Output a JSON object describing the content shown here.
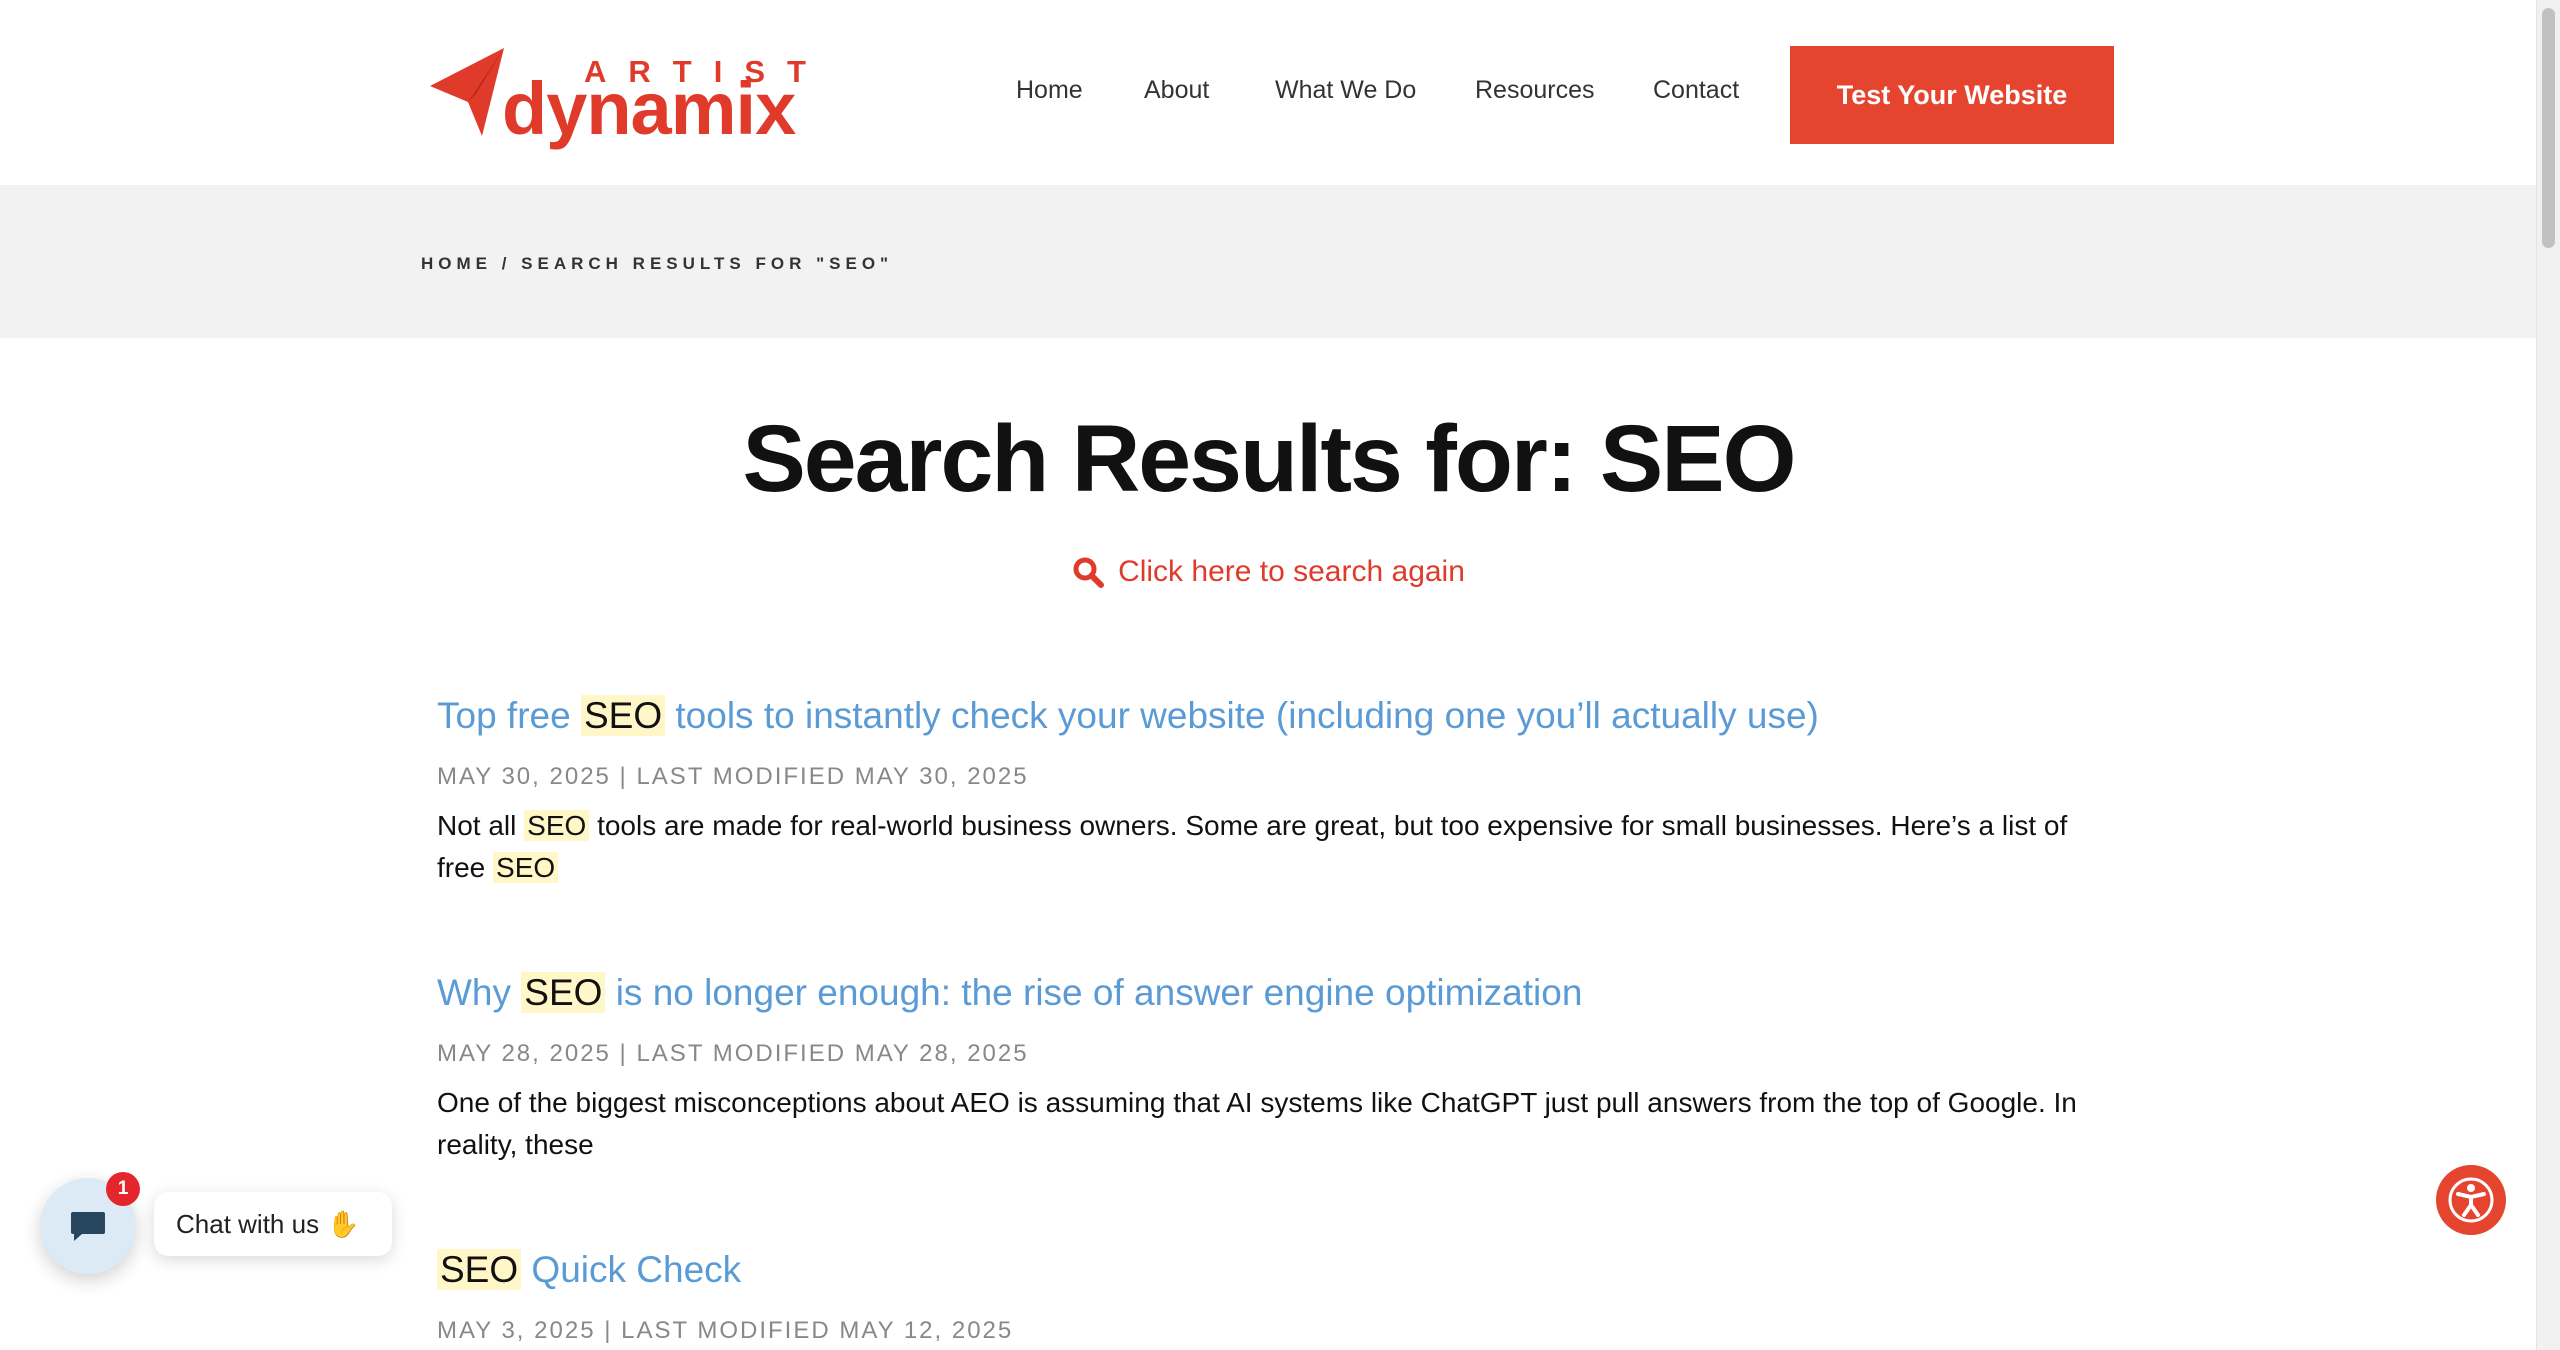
{
  "brand": {
    "logo_top": "ARTIST",
    "logo_main": "dynamix",
    "accent": "#e5452f",
    "link_color": "#5b9bd5"
  },
  "nav": {
    "items": [
      {
        "label": "Home"
      },
      {
        "label": "About"
      },
      {
        "label": "What We Do"
      },
      {
        "label": "Resources"
      },
      {
        "label": "Contact"
      }
    ],
    "cta_label": "Test Your Website"
  },
  "breadcrumb": {
    "home": "HOME",
    "separator": " / ",
    "current": "SEARCH RESULTS FOR \"SEO\""
  },
  "page": {
    "title": "Search Results for: SEO",
    "search_again": "Click here to search again",
    "search_icon": "search-icon"
  },
  "results": [
    {
      "title_pre": "Top free ",
      "title_hl": "SEO",
      "title_post": " tools to instantly check your website (including one you’ll actually use)",
      "meta": "MAY 30, 2025 | LAST MODIFIED MAY 30, 2025",
      "excerpt_pre": "Not all ",
      "excerpt_hl": "SEO",
      "excerpt_mid": " tools are made for real-world business owners. Some are great, but too expensive for small businesses. Here’s a list of free ",
      "excerpt_hl2": "SEO",
      "excerpt_post": ""
    },
    {
      "title_pre": "Why ",
      "title_hl": "SEO",
      "title_post": " is no longer enough: the rise of answer engine optimization",
      "meta": "MAY 28, 2025 | LAST MODIFIED MAY 28, 2025",
      "excerpt_pre": "One of the biggest misconceptions about AEO is assuming that AI systems like ChatGPT just pull answers from the top of Google. In reality, these",
      "excerpt_hl": "",
      "excerpt_mid": "",
      "excerpt_hl2": "",
      "excerpt_post": ""
    },
    {
      "title_pre": "",
      "title_hl": "SEO",
      "title_post": " Quick Check",
      "meta": "MAY 3, 2025 | LAST MODIFIED MAY 12, 2025",
      "excerpt_pre": "",
      "excerpt_hl": "",
      "excerpt_mid": "",
      "excerpt_hl2": "",
      "excerpt_post": ""
    }
  ],
  "chat": {
    "label": "Chat with us",
    "badge": "1",
    "icon": "chat-bubble-icon",
    "emoji_icon": "waving-hand-icon"
  },
  "accessibility": {
    "icon": "accessibility-icon"
  }
}
